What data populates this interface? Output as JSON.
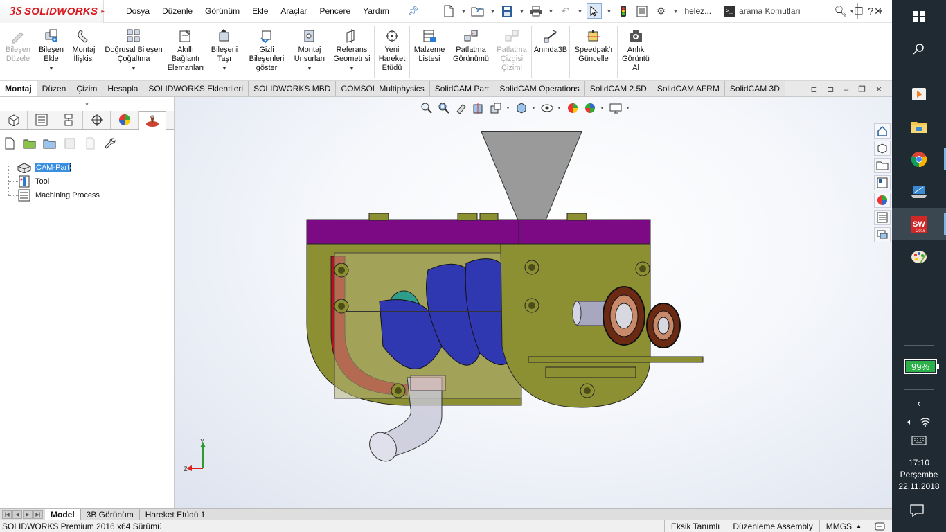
{
  "app": {
    "brand": "SOLIDWORKS",
    "brand_prefix": "3S"
  },
  "menu": [
    "Dosya",
    "Düzenle",
    "Görünüm",
    "Ekle",
    "Araçlar",
    "Pencere",
    "Yardım"
  ],
  "user": "helez...",
  "search": {
    "placeholder": "arama Komutları",
    "prompt_glyph": ">_"
  },
  "help_glyph": "?",
  "window_controls": {
    "minimize": "–",
    "restore": "❐",
    "close": "✕"
  },
  "command_manager": [
    {
      "label": "Bileşen\nDüzele",
      "icon": "edit-component-icon",
      "disabled": true
    },
    {
      "label": "Bileşen\nEkle",
      "icon": "insert-component-icon",
      "disabled": false,
      "dropdown": true
    },
    {
      "label": "Montaj\nİlişkisi",
      "icon": "mate-icon",
      "disabled": false
    },
    {
      "label": "Doğrusal Bileşen\nÇoğaltma",
      "icon": "linear-pattern-icon",
      "disabled": false,
      "dropdown": true
    },
    {
      "label": "Akıllı\nBağlantı\nElemanları",
      "icon": "smart-fasteners-icon",
      "disabled": false
    },
    {
      "label": "Bileşeni\nTaşı",
      "icon": "move-component-icon",
      "disabled": false,
      "dropdown": true
    },
    {
      "label": "Gizli\nBileşenleri\ngöster",
      "icon": "show-hidden-icon",
      "disabled": false
    },
    {
      "label": "Montaj\nUnsurları",
      "icon": "assembly-features-icon",
      "disabled": false,
      "dropdown": true
    },
    {
      "label": "Referans\nGeometrisi",
      "icon": "reference-geometry-icon",
      "disabled": false,
      "dropdown": true
    },
    {
      "label": "Yeni\nHareket\nEtüdü",
      "icon": "new-motion-study-icon",
      "disabled": false
    },
    {
      "label": "Malzeme\nListesi",
      "icon": "bill-of-materials-icon",
      "disabled": false
    },
    {
      "label": "Patlatma\nGörünümü",
      "icon": "exploded-view-icon",
      "disabled": false
    },
    {
      "label": "Patlatma\nÇizgisi\nÇizimi",
      "icon": "explode-line-icon",
      "disabled": true
    },
    {
      "label": "Anında3B",
      "icon": "instant3d-icon",
      "disabled": false
    },
    {
      "label": "Speedpak'ı\nGüncelle",
      "icon": "speedpak-icon",
      "disabled": false
    },
    {
      "label": "Anlık\nGörüntü\nAl",
      "icon": "snapshot-icon",
      "disabled": false
    }
  ],
  "tabs": [
    "Montaj",
    "Düzen",
    "Çizim",
    "Hesapla",
    "SOLIDWORKS Eklentileri",
    "SOLIDWORKS MBD",
    "COMSOL Multiphysics",
    "SolidCAM Part",
    "SolidCAM Operations",
    "SolidCAM 2.5D",
    "SolidCAM AFRM",
    "SolidCAM 3D"
  ],
  "active_tab": "Montaj",
  "tree": [
    {
      "label": "CAM-Part",
      "icon": "cam-part-icon",
      "selected": true
    },
    {
      "label": "Tool",
      "icon": "tool-icon",
      "selected": false
    },
    {
      "label": "Machining Process",
      "icon": "machining-process-icon",
      "selected": false
    }
  ],
  "triad": {
    "y": "Y",
    "z": "Z"
  },
  "bottom_tabs": [
    "Model",
    "3B Görünüm",
    "Hareket Etüdü 1"
  ],
  "active_bottom_tab": "Model",
  "status": {
    "version": "SOLIDWORKS Premium 2016 x64 Sürümü",
    "definition": "Eksik Tanımlı",
    "mode": "Düzenleme Assembly",
    "units": "MMGS",
    "units_caret": "▲"
  },
  "taskbar": {
    "battery": "99%",
    "time": "17:10",
    "day": "Perşembe",
    "date": "22.11.2018"
  }
}
